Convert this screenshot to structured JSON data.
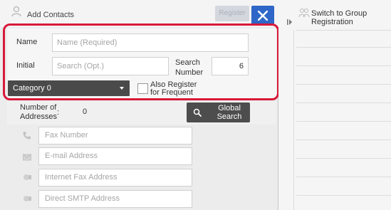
{
  "dialog": {
    "title": "Add Contacts",
    "register_label": "Register"
  },
  "form": {
    "name_label": "Name",
    "name_placeholder": "Name (Required)",
    "initial_label": "Initial",
    "initial_placeholder": "Search (Opt.)",
    "search_number_label_line1": "Search",
    "search_number_label_line2": "Number",
    "search_number_value": "6",
    "category_value": "Category 0",
    "also_register_line1": "Also Register",
    "also_register_line2": "for Frequent Use"
  },
  "addresses": {
    "count_label_line1": "Number of",
    "count_label_line2": "Addresses",
    "count_separator": ":",
    "count_value": "0",
    "global_search_line1": "Global",
    "global_search_line2": "Search",
    "fields": [
      {
        "placeholder": "Fax Number",
        "icon": "phone-icon"
      },
      {
        "placeholder": "E-mail Address",
        "icon": "envelope-icon"
      },
      {
        "placeholder": "Internet Fax Address",
        "icon": "internet-fax-icon"
      },
      {
        "placeholder": "Direct SMTP Address",
        "icon": "smtp-icon"
      }
    ]
  },
  "side_panel": {
    "title_line1": "Switch to Group",
    "title_line2": "Registration"
  },
  "colors": {
    "highlight_frame": "#d8193a",
    "close_button": "#2e67c7"
  }
}
